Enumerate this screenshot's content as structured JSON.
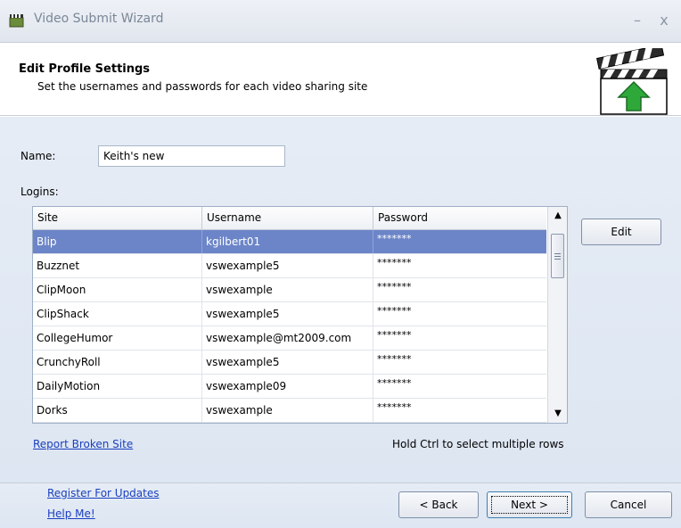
{
  "window": {
    "title": "Video Submit Wizard",
    "minimize_glyph": "–",
    "close_glyph": "x"
  },
  "header": {
    "title": "Edit Profile Settings",
    "subtitle": "Set the usernames and passwords for each video sharing site"
  },
  "form": {
    "name_label": "Name:",
    "name_value": "Keith's new",
    "logins_label": "Logins:"
  },
  "grid": {
    "columns": [
      "Site",
      "Username",
      "Password"
    ],
    "rows": [
      {
        "site": "Blip",
        "username": "kgilbert01",
        "password": "*******",
        "selected": true
      },
      {
        "site": "Buzznet",
        "username": "vswexample5",
        "password": "*******"
      },
      {
        "site": "ClipMoon",
        "username": "vswexample",
        "password": "*******"
      },
      {
        "site": "ClipShack",
        "username": "vswexample5",
        "password": "*******"
      },
      {
        "site": "CollegeHumor",
        "username": "vswexample@mt2009.com",
        "password": "*******"
      },
      {
        "site": "CrunchyRoll",
        "username": "vswexample5",
        "password": "*******"
      },
      {
        "site": "DailyMotion",
        "username": "vswexample09",
        "password": "*******"
      },
      {
        "site": "Dorks",
        "username": "vswexample",
        "password": "*******"
      }
    ],
    "scroll_position": 0.05
  },
  "buttons": {
    "edit": "Edit",
    "back": "< Back",
    "next": "Next >",
    "cancel": "Cancel"
  },
  "links": {
    "report_broken_site": "Report Broken Site",
    "register_for_updates": "Register For Updates",
    "help_me": "Help Me!"
  },
  "hint": "Hold Ctrl to select multiple rows",
  "icons": {
    "app": "clapperboard-icon",
    "header": "clapperboard-upload-icon",
    "accent_green": "#2fa83a",
    "selection_blue": "#6c85c8"
  }
}
